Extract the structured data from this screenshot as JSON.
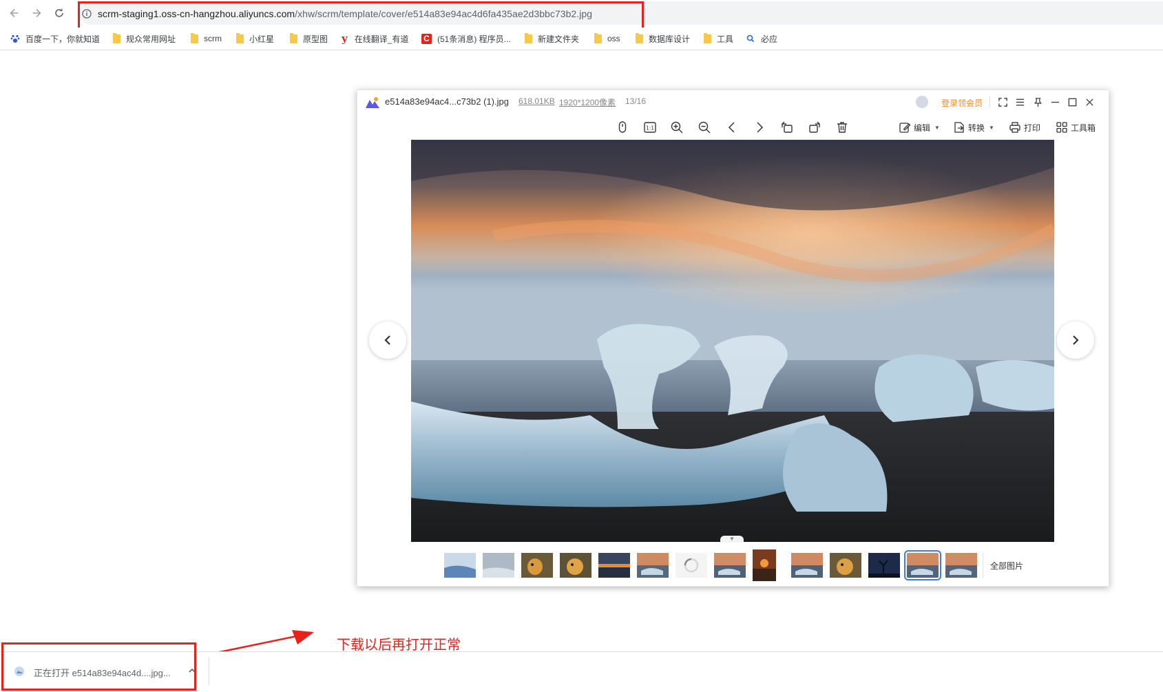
{
  "browser": {
    "url_host": "scrm-staging1.oss-cn-hangzhou.aliyuncs.com",
    "url_path": "/xhw/scrm/template/cover/e514a83e94ac4d6fa435ae2d3bbc73b2.jpg",
    "bookmarks": [
      {
        "label": "百度一下，你就知道",
        "icon": "baidu-icon"
      },
      {
        "label": "规众常用网址",
        "icon": "folder-icon"
      },
      {
        "label": "scrm",
        "icon": "folder-icon"
      },
      {
        "label": "小红星",
        "icon": "folder-icon"
      },
      {
        "label": "原型图",
        "icon": "folder-icon"
      },
      {
        "label": "在线翻译_有道",
        "icon": "youdao-icon"
      },
      {
        "label": "(51条消息) 程序员...",
        "icon": "csdn-icon"
      },
      {
        "label": "新建文件夹",
        "icon": "folder-icon"
      },
      {
        "label": "oss",
        "icon": "folder-icon"
      },
      {
        "label": "数据库设计",
        "icon": "folder-icon"
      },
      {
        "label": "工具",
        "icon": "folder-icon"
      },
      {
        "label": "必应",
        "icon": "bing-icon"
      }
    ]
  },
  "viewer": {
    "filename": "e514a83e94ac4...c73b2 (1).jpg",
    "file_size": "618.01KB",
    "dimensions": "1920*1200像素",
    "position": "13/16",
    "member_link": "登录领会员",
    "toolbar": {
      "edit_label": "编辑",
      "convert_label": "转换",
      "print_label": "打印",
      "toolbox_label": "工具箱"
    },
    "all_images_label": "全部图片",
    "thumbnail_count": 14,
    "selected_thumbnail": 13
  },
  "annotation": {
    "text": "下载以后再打开正常",
    "color": "#e8221b"
  },
  "download": {
    "status_text": "正在打开 e514a83e94ac4d....jpg..."
  },
  "colors": {
    "accent": "#3b7bea",
    "member": "#f08a1c"
  }
}
